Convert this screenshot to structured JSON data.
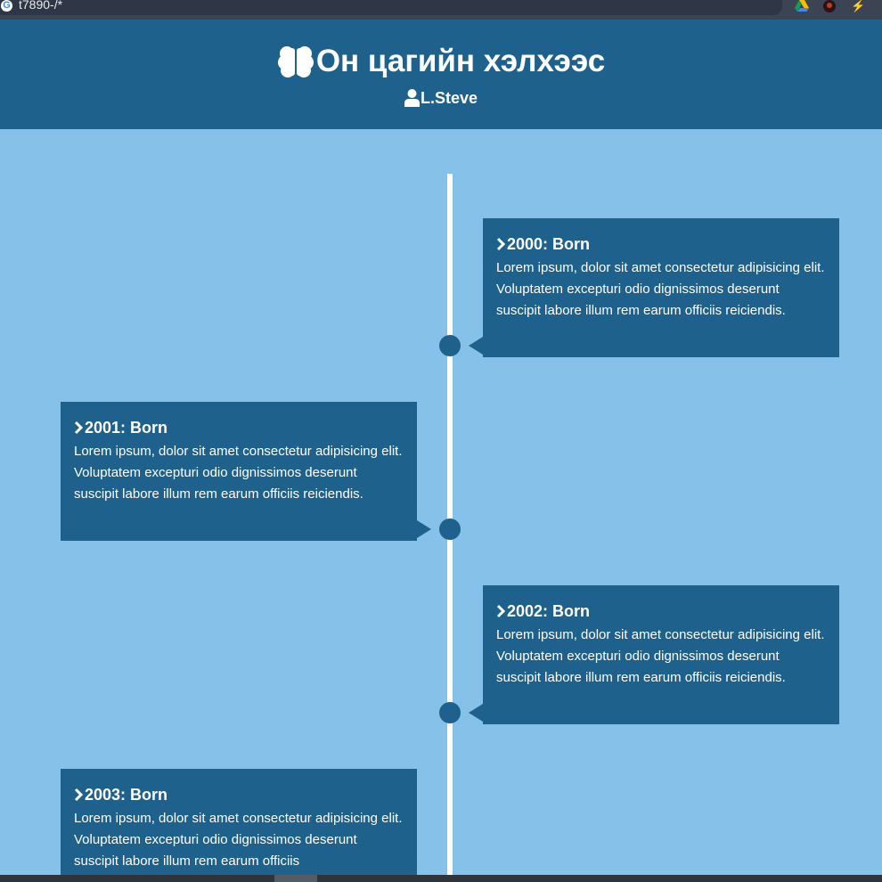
{
  "browser": {
    "url": "t7890-/*",
    "icons": [
      "google-g-icon",
      "google-drive-icon",
      "screen-recorder-icon",
      "lightning-extension-icon"
    ]
  },
  "header": {
    "title": "Он цагийн хэлхээс",
    "author": "L.Steve",
    "title_icon": "brain-icon",
    "author_icon": "user-icon"
  },
  "timeline": {
    "items": [
      {
        "title": "2000: Born",
        "text": "Lorem ipsum, dolor sit amet consectetur adipisicing elit. Voluptatem excepturi odio dignissimos deserunt suscipit labore illum rem earum officiis reiciendis.",
        "side": "right"
      },
      {
        "title": "2001: Born",
        "text": "Lorem ipsum, dolor sit amet consectetur adipisicing elit. Voluptatem excepturi odio dignissimos deserunt suscipit labore illum rem earum officiis reiciendis.",
        "side": "left"
      },
      {
        "title": "2002: Born",
        "text": "Lorem ipsum, dolor sit amet consectetur adipisicing elit. Voluptatem excepturi odio dignissimos deserunt suscipit labore illum rem earum officiis reiciendis.",
        "side": "right"
      },
      {
        "title": "2003: Born",
        "text": "Lorem ipsum, dolor sit amet consectetur adipisicing elit. Voluptatem excepturi odio dignissimos deserunt suscipit labore illum rem earum officiis",
        "side": "left"
      }
    ]
  },
  "colors": {
    "page_background": "#85c1e9",
    "header_background": "#1f618d",
    "card_background": "#1f618d",
    "timeline_line": "#ffffff",
    "text": "#ffffff"
  }
}
